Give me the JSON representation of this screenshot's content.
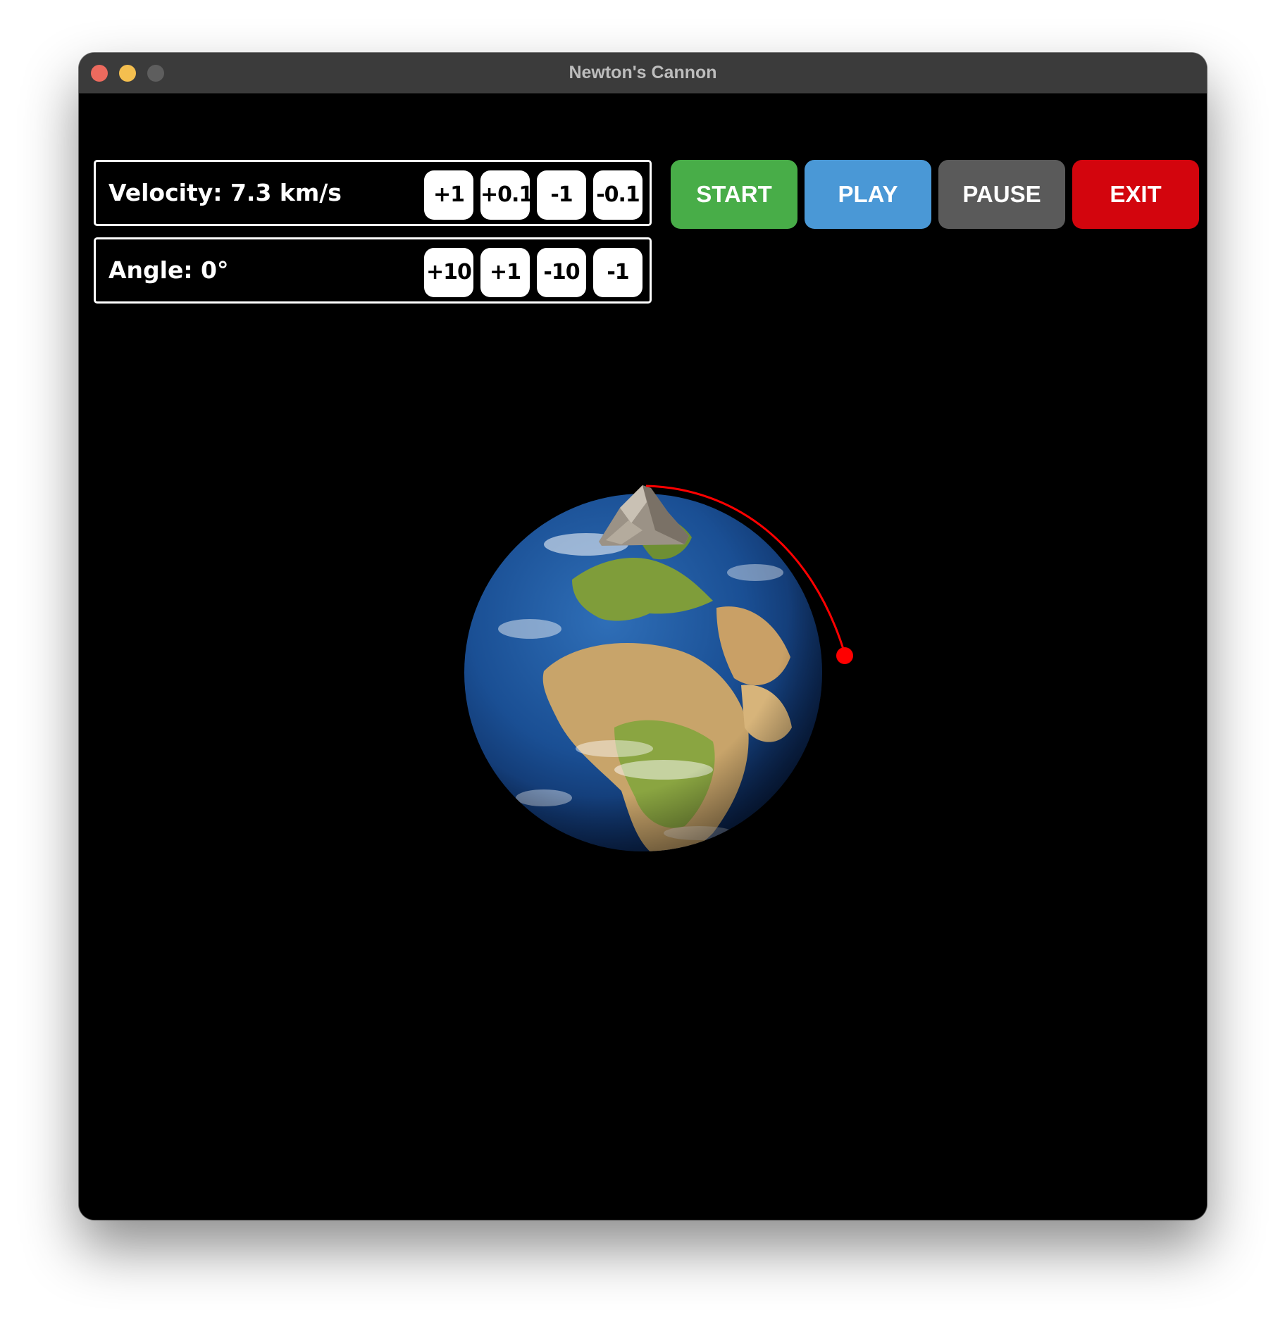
{
  "window": {
    "title": "Newton's Cannon"
  },
  "controls": {
    "velocity": {
      "label": "Velocity: 7.3 km/s",
      "steppers": [
        "+1",
        "+0.1",
        "-1",
        "-0.1"
      ]
    },
    "angle": {
      "label": "Angle: 0°",
      "steppers": [
        "+10",
        "+1",
        "-10",
        "-1"
      ]
    }
  },
  "actions": {
    "start": "START",
    "play": "PLAY",
    "pause": "PAUSE",
    "exit": "EXIT"
  },
  "colors": {
    "start": "#48ad48",
    "play": "#4a98d6",
    "pause": "#5a5a5a",
    "exit": "#d3050d",
    "trajectory": "#ff0000",
    "background": "#000000"
  },
  "scene": {
    "planet_icon": "earth-globe",
    "cannon_icon": "mountain-peak"
  }
}
